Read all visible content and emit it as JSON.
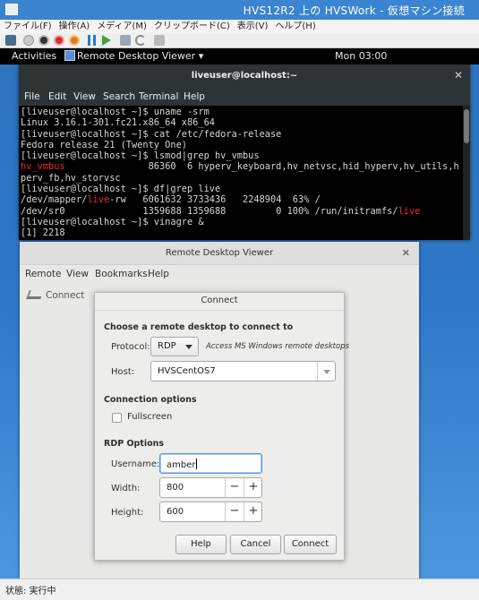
{
  "window": {
    "title": "HVS12R2 上の HVSWork - 仮想マシン接続",
    "menu": [
      "ファイル(F)",
      "操作(A)",
      "メディア(M)",
      "クリップボード(C)",
      "表示(V)",
      "ヘルプ(H)"
    ]
  },
  "gnome": {
    "activities": "Activities",
    "app_menu": "Remote Desktop Viewer ▾",
    "clock": "Mon 03:00"
  },
  "terminal": {
    "title": "liveuser@localhost:~",
    "menu": [
      "File",
      "Edit",
      "View",
      "Search",
      "Terminal",
      "Help"
    ],
    "lines": [
      "[liveuser@localhost ~]$ uname -srm",
      "Linux 3.16.1-301.fc21.x86_64 x86_64",
      "[liveuser@localhost ~]$ cat /etc/fedora-release",
      "Fedora release 21 (Twenty One)",
      "[liveuser@localhost ~]$ lsmod|grep hv_vmbus",
      "hv_vmbus               86360  6 hyperv_keyboard,hv_netvsc,hid_hyperv,hv_utils,hy",
      "perv_fb,hv_storvsc",
      "[liveuser@localhost ~]$ df|grep live",
      "/dev/mapper/live-rw   6061632 3733436   2248904  63% /",
      "/dev/sr0              1359688 1359688         0 100% /run/initramfs/live",
      "[liveuser@localhost ~]$ vinagre &",
      "[1] 2218"
    ],
    "hl": {
      "vmbus": "hv_vmbus",
      "live": "live"
    }
  },
  "rdv": {
    "title": "Remote Desktop Viewer",
    "menu": [
      "Remote",
      "View",
      "Bookmarks",
      "Help"
    ],
    "toolbar_connect": "Connect"
  },
  "dialog": {
    "title": "Connect",
    "section_choose": "Choose a remote desktop to connect to",
    "protocol_label": "Protocol:",
    "protocol_value": "RDP",
    "protocol_hint": "Access MS Windows remote desktops",
    "host_label": "Host:",
    "host_value": "HVSCentOS7",
    "section_options": "Connection options",
    "fullscreen_label": "Fullscreen",
    "fullscreen_checked": false,
    "section_rdp": "RDP Options",
    "username_label": "Username:",
    "username_value": "amber",
    "width_label": "Width:",
    "width_value": "800",
    "height_label": "Height:",
    "height_value": "600",
    "minus": "−",
    "plus": "+",
    "btn_help": "Help",
    "btn_cancel": "Cancel",
    "btn_connect": "Connect"
  },
  "status": {
    "text": "状態: 実行中"
  }
}
